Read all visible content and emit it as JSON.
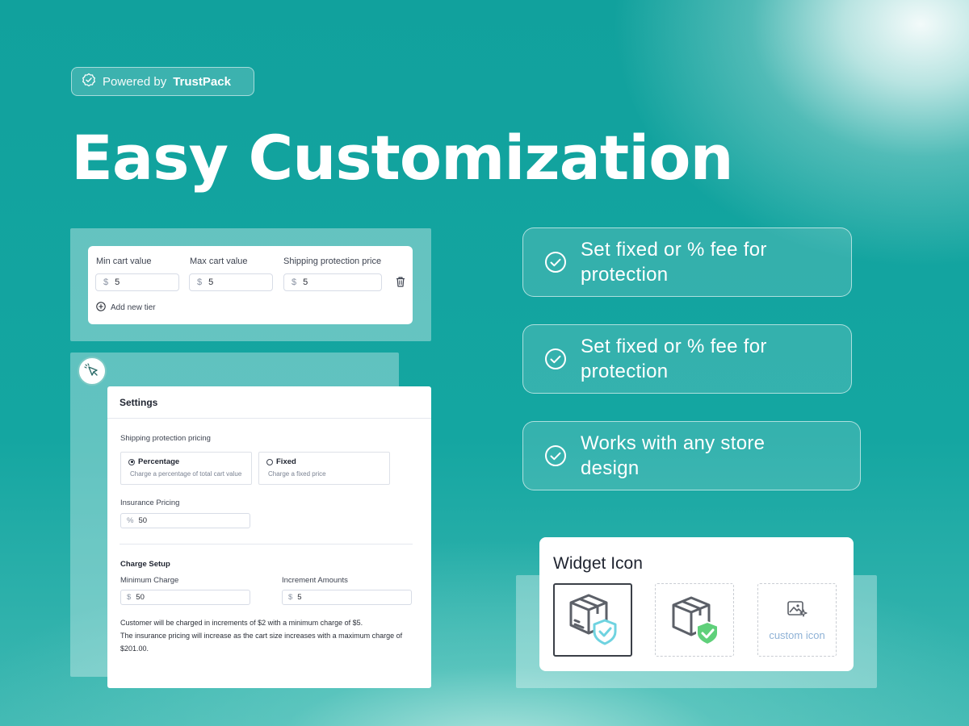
{
  "badge": {
    "prefix": "Powered by",
    "brand": "TrustPack",
    "icon": "badge-check-icon"
  },
  "headline": "Easy Customization",
  "tier_panel": {
    "columns": [
      "Min cart value",
      "Max cart value",
      "Shipping protection price"
    ],
    "currency": "$",
    "values": [
      "5",
      "5",
      "5"
    ],
    "add_label": "Add new tier"
  },
  "settings": {
    "title": "Settings",
    "pricing_label": "Shipping protection pricing",
    "options": [
      {
        "label": "Percentage",
        "desc": "Charge a percentage of total cart value",
        "selected": true
      },
      {
        "label": "Fixed",
        "desc": "Charge a fixed price",
        "selected": false
      }
    ],
    "insurance_label": "Insurance Pricing",
    "insurance_unit": "%",
    "insurance_value": "50",
    "charge_title": "Charge Setup",
    "min_charge_label": "Minimum Charge",
    "min_charge_currency": "$",
    "min_charge_value": "50",
    "increment_label": "Increment Amounts",
    "increment_currency": "$",
    "increment_value": "5",
    "note_line1": "Customer will be charged in increments of $2 with a minimum charge of $5.",
    "note_line2": "The insurance pricing will increase as the cart size increases with a maximum charge of",
    "note_line3": "$201.00."
  },
  "features": [
    {
      "line1": "Set fixed or % fee for",
      "line2": "protection"
    },
    {
      "line1": "Set fixed or % fee for",
      "line2": "protection"
    },
    {
      "line1": "Works with any store",
      "line2": "design"
    }
  ],
  "widget": {
    "title": "Widget Icon",
    "custom_label": "custom icon",
    "icons": [
      "package-shield-outline-icon",
      "package-shield-green-icon",
      "image-sparkle-icon"
    ]
  },
  "colors": {
    "teal": "#13a39f",
    "white": "#ffffff",
    "check_green": "#5fd07a",
    "shield_blue": "#6fd3e0"
  }
}
